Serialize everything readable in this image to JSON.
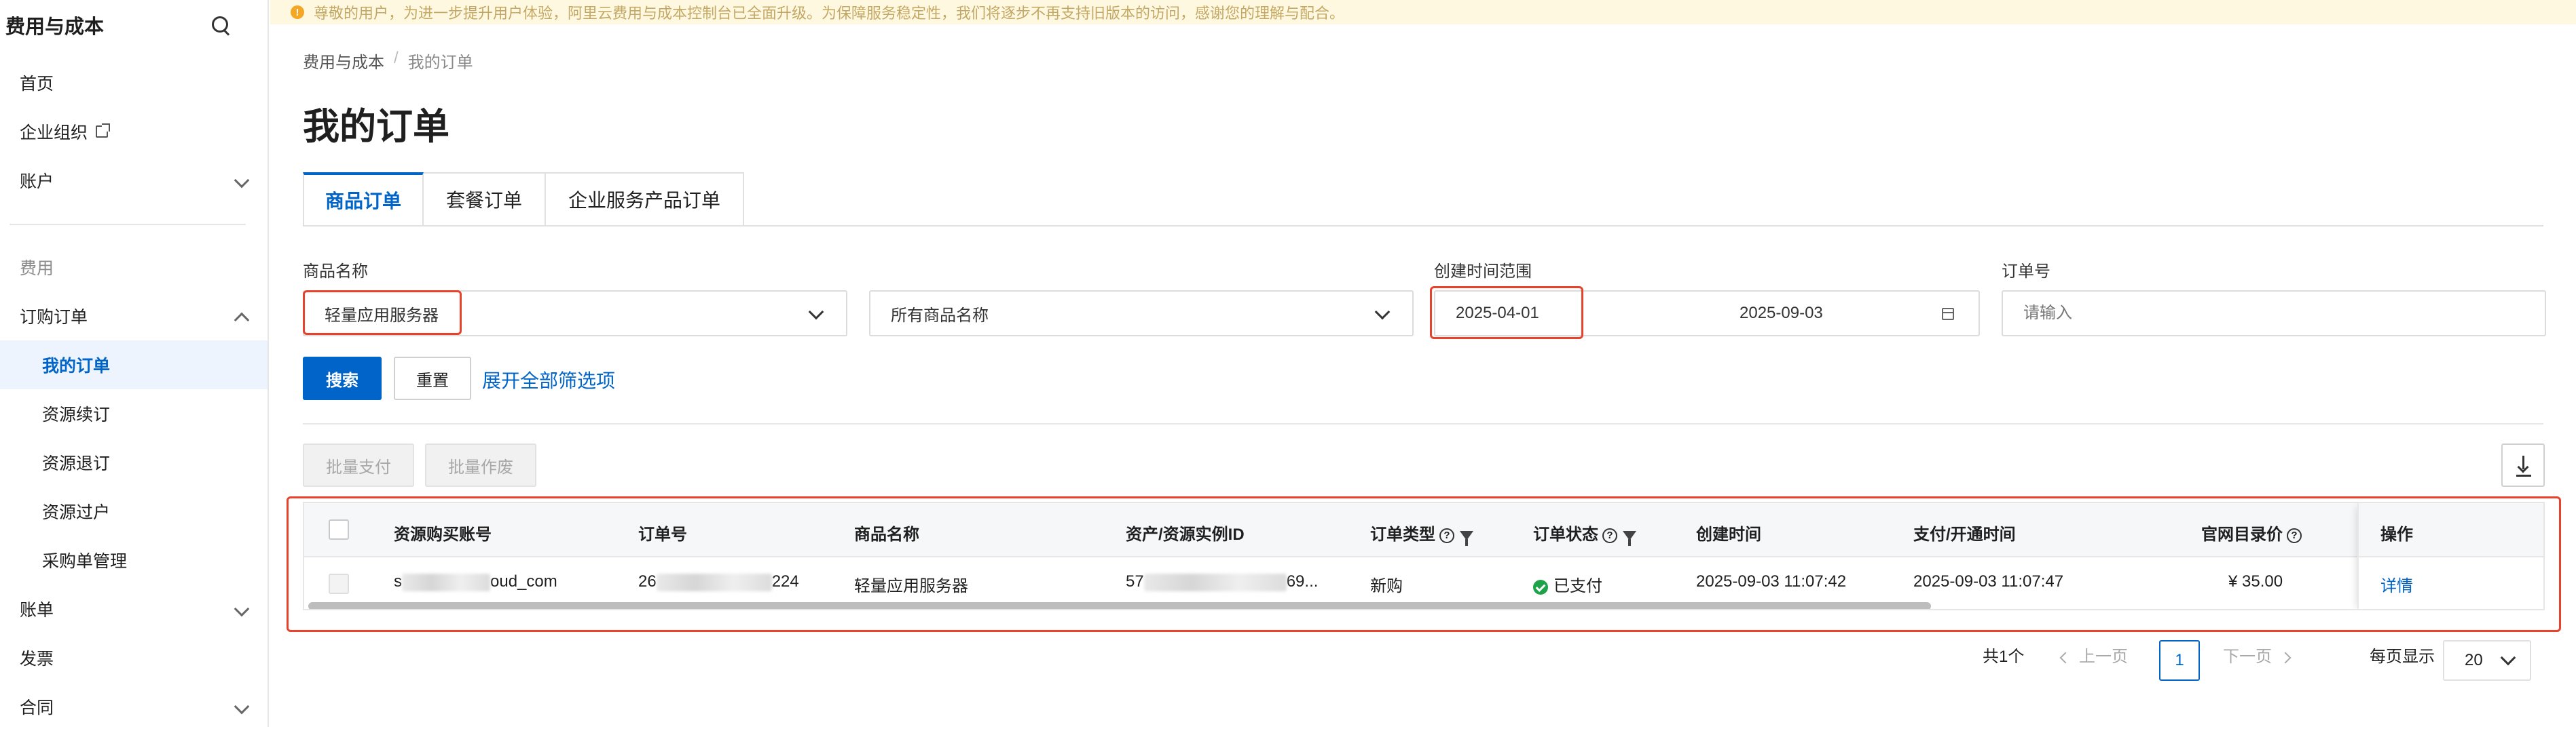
{
  "notice": {
    "text": "尊敬的用户，为进一步提升用户体验，阿里云费用与成本控制台已全面升级。为保障服务稳定性，我们将逐步不再支持旧版本的访问，感谢您的理解与配合。"
  },
  "sidebar": {
    "title": "费用与成本",
    "items": {
      "home": "首页",
      "enterprise": "企业组织",
      "account": "账户",
      "fee_group": "费用",
      "orders": "订购订单",
      "my_orders": "我的订单",
      "renew": "资源续订",
      "refund": "资源退订",
      "transfer": "资源过户",
      "purchase_mgmt": "采购单管理",
      "bills": "账单",
      "invoice": "发票",
      "contract": "合同"
    }
  },
  "breadcrumb": {
    "root": "费用与成本",
    "sep": "/",
    "current": "我的订单"
  },
  "page_title": "我的订单",
  "tabs": [
    "商品订单",
    "套餐订单",
    "企业服务产品订单"
  ],
  "filters": {
    "product_name_label": "商品名称",
    "product_select_value": "轻量应用服务器",
    "product_name_select_value": "所有商品名称",
    "date_range_label": "创建时间范围",
    "date_start": "2025-04-01",
    "date_end": "2025-09-03",
    "order_no_label": "订单号",
    "order_no_placeholder": "请输入"
  },
  "buttons": {
    "search": "搜索",
    "reset": "重置",
    "expand_filters": "展开全部筛选项",
    "batch_pay": "批量支付",
    "batch_void": "批量作废"
  },
  "table": {
    "columns": {
      "buyer": "资源购买账号",
      "order_no": "订单号",
      "product": "商品名称",
      "instance": "资产/资源实例ID",
      "order_type": "订单类型",
      "order_status": "订单状态",
      "created": "创建时间",
      "paid": "支付/开通时间",
      "price": "官网目录价",
      "action": "操作"
    },
    "rows": [
      {
        "buyer_prefix": "s",
        "buyer_suffix": "oud_com",
        "order_prefix": "26",
        "order_suffix": "224",
        "product": "轻量应用服务器",
        "instance_prefix": "57",
        "instance_suffix": "69...",
        "order_type": "新购",
        "status": "已支付",
        "created": "2025-09-03 11:07:42",
        "paid": "2025-09-03 11:07:47",
        "price": "¥ 35.00",
        "action": "详情"
      }
    ]
  },
  "pagination": {
    "total": "共1个",
    "prev": "上一页",
    "page": "1",
    "next": "下一页",
    "per_page_label": "每页显示",
    "per_page_value": "20"
  },
  "colors": {
    "primary": "#0064c8",
    "highlight_box": "#e8412c",
    "success": "#1fa34a",
    "notice_bg": "#fff8e1"
  }
}
